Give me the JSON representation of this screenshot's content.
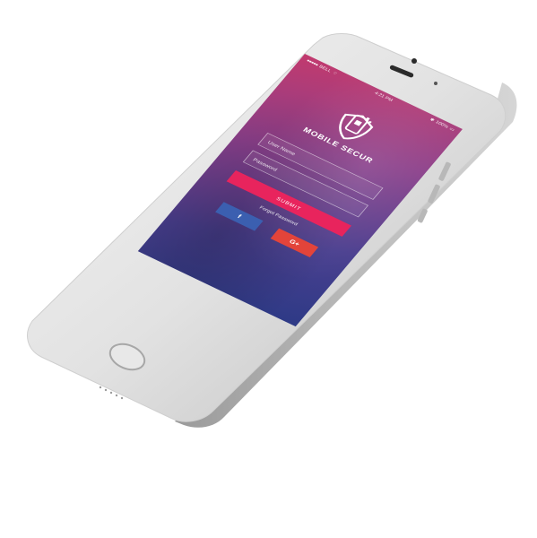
{
  "status_bar": {
    "carrier": "BELL",
    "time": "4:21 PM",
    "battery": "100%"
  },
  "app": {
    "logo_text": "MOBILE SECUR"
  },
  "login": {
    "username_placeholder": "User Name",
    "password_placeholder": "Password",
    "submit_label": "SUBMIT",
    "forgot_label": "Forgot Password"
  },
  "social": {
    "facebook_label": "f",
    "google_label": "G+"
  },
  "colors": {
    "submit": "#e8245d",
    "facebook": "#3b5fb0",
    "google": "#e3443a",
    "gradient_top": "#c23a6e",
    "gradient_bottom": "#2d3a86"
  }
}
